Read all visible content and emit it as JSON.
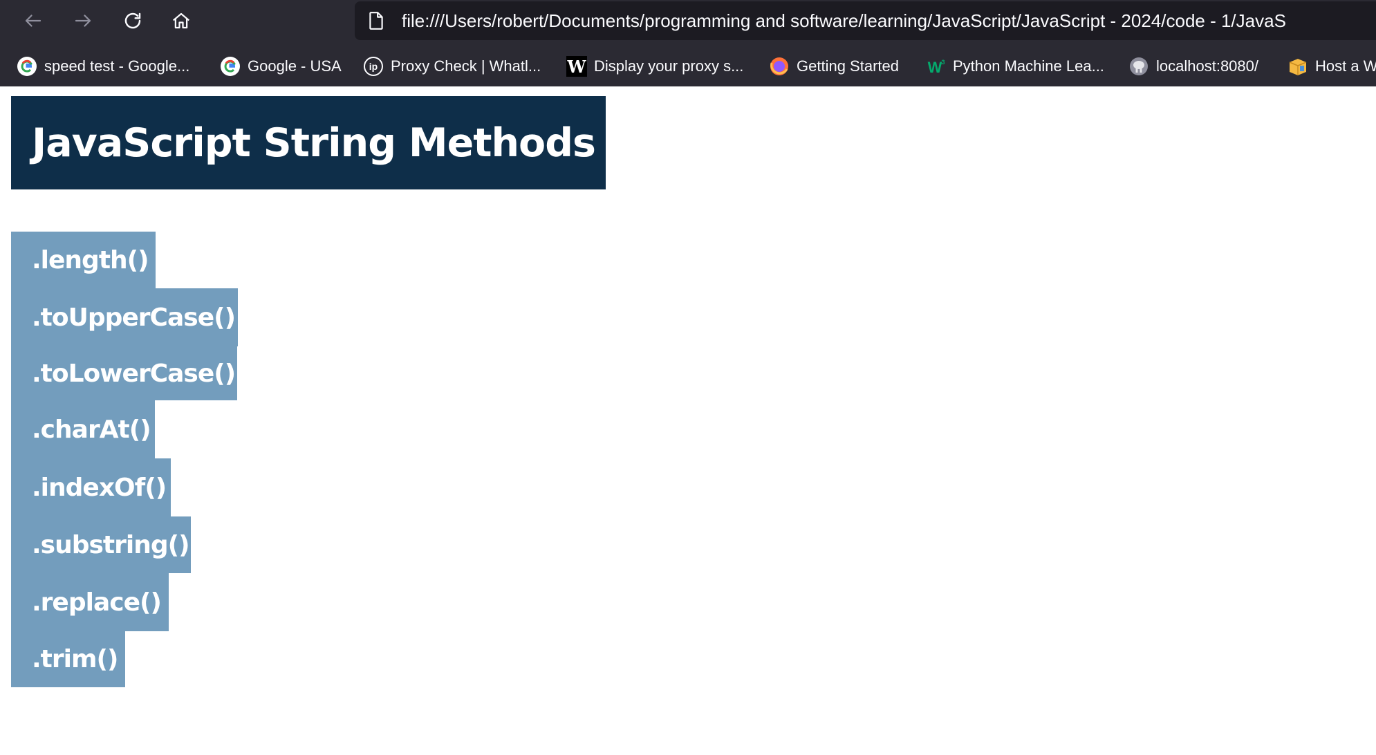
{
  "browser": {
    "address": "file:///Users/robert/Documents/programming and software/learning/JavaScript/JavaScript - 2024/code - 1/JavaS",
    "icons": {
      "back": "arrow-left-icon",
      "forward": "arrow-right-icon",
      "reload": "reload-icon",
      "home": "home-icon",
      "page": "page-icon"
    },
    "bookmarks": [
      {
        "label": "speed test - Google...",
        "icon": "google-icon"
      },
      {
        "label": "Google - USA",
        "icon": "google-icon"
      },
      {
        "label": "Proxy Check | Whatl...",
        "icon": "ip-icon"
      },
      {
        "label": "Display your proxy s...",
        "icon": "w-icon"
      },
      {
        "label": "Getting Started",
        "icon": "firefox-icon"
      },
      {
        "label": "Python Machine Lea...",
        "icon": "w3-icon"
      },
      {
        "label": "localhost:8080/",
        "icon": "elephant-icon"
      },
      {
        "label": "Host a W",
        "icon": "box-icon"
      }
    ]
  },
  "page": {
    "title": "JavaScript String Methods",
    "methods": [
      ".length()",
      ".toUpperCase()",
      ".toLowerCase()",
      ".charAt()",
      ".indexOf()",
      ".substring()",
      ".replace()",
      ".trim()"
    ]
  },
  "colors": {
    "chrome": "#2b2a33",
    "urlbar": "#1c1b22",
    "title_bg": "#0e2e49",
    "item_bg": "#739dbd",
    "text": "#ffffff"
  }
}
